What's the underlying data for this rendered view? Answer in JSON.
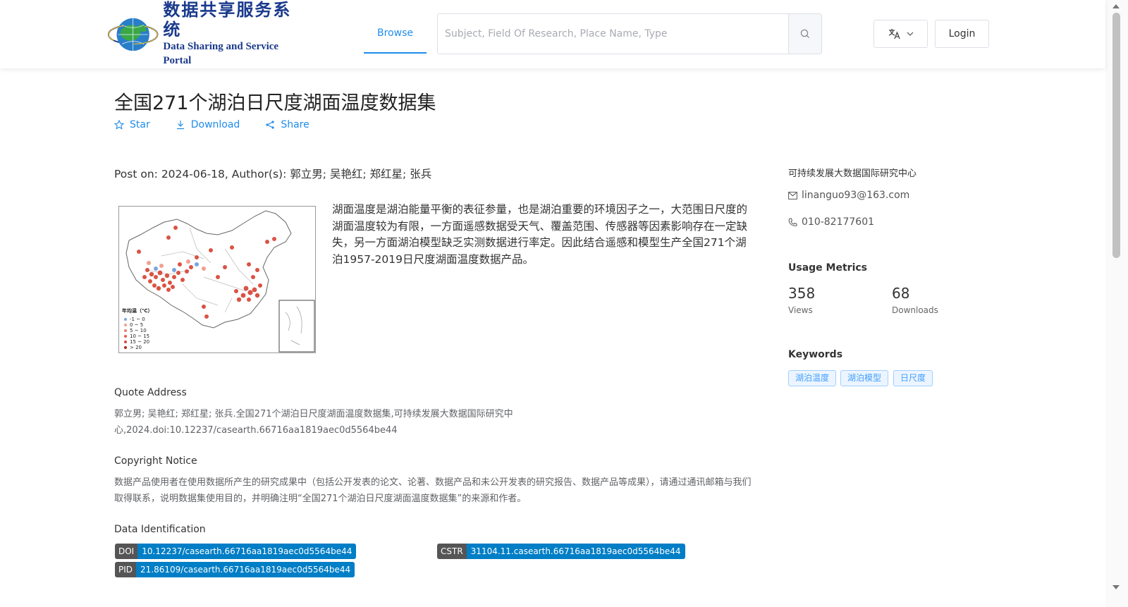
{
  "header": {
    "logo_cn": "数据共享服务系统",
    "logo_en": "Data Sharing and Service Portal",
    "nav_browse": "Browse",
    "search_placeholder": "Subject, Field Of Research, Place Name, Type",
    "login": "Login",
    "accent_color": "#1f8ceb"
  },
  "dataset": {
    "title": "全国271个湖泊日尺度湖面温度数据集",
    "actions": {
      "star": "Star",
      "download": "Download",
      "share": "Share"
    },
    "post_line": "Post on: 2024-06-18, Author(s): 郭立男; 吴艳红; 郑红星; 张兵",
    "description": "湖面温度是湖泊能量平衡的表征参量，也是湖泊重要的环境因子之一，大范围日尺度的湖面温度较为有限，一方面遥感数据受天气、覆盖范围、传感器等因素影响存在一定缺失，另一方面湖泊模型缺乏实测数据进行率定。因此结合遥感和模型生产全国271个湖泊1957-2019日尺度湖面温度数据产品。",
    "map_legend": {
      "title": "年均温（℃）",
      "items": [
        "-1 ~ 0",
        "0 ~ 5",
        "5 ~ 10",
        "10 ~ 15",
        "15 ~ 20",
        "> 20"
      ]
    }
  },
  "quote": {
    "title": "Quote Address",
    "text": "郭立男; 吴艳红; 郑红星; 张兵.全国271个湖泊日尺度湖面温度数据集,可持续发展大数据国际研究中心,2024.doi:10.12237/casearth.66716aa1819aec0d5564be44"
  },
  "copyright": {
    "title": "Copyright Notice",
    "text": "数据产品使用者在使用数据所产生的研究成果中（包括公开发表的论文、论著、数据产品和未公开发表的研究报告、数据产品等成果），请通过通讯邮箱与我们取得联系，说明数据集使用目的，并明确注明“全国271个湖泊日尺度湖面温度数据集”的来源和作者。"
  },
  "identification": {
    "title": "Data Identification",
    "doi_label": "DOI",
    "doi": "10.12237/casearth.66716aa1819aec0d5564be44",
    "cstr_label": "CSTR",
    "cstr": "31104.11.casearth.66716aa1819aec0d5564be44",
    "pid_label": "PID",
    "pid": "21.86109/casearth.66716aa1819aec0d5564be44"
  },
  "sidebar": {
    "org": "可持续发展大数据国际研究中心",
    "email": "linanguo93@163.com",
    "phone": "010-82177601",
    "metrics_title": "Usage Metrics",
    "views": "358",
    "views_label": "Views",
    "downloads": "68",
    "downloads_label": "Downloads",
    "keywords_title": "Keywords",
    "keywords": [
      "湖泊温度",
      "湖泊模型",
      "日尺度"
    ]
  }
}
